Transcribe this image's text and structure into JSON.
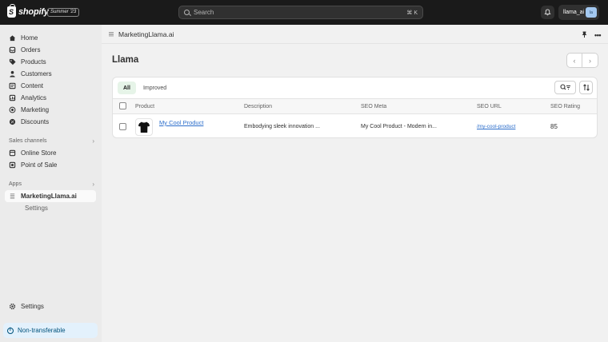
{
  "topbar": {
    "brand": "shopify",
    "edition": "Summer '23",
    "search_placeholder": "Search",
    "search_shortcut": "⌘ K",
    "account_name": "llama_ai",
    "avatar_initials": "la"
  },
  "sidebar": {
    "main_items": [
      {
        "label": "Home",
        "icon": "home-icon"
      },
      {
        "label": "Orders",
        "icon": "orders-icon"
      },
      {
        "label": "Products",
        "icon": "tag-icon"
      },
      {
        "label": "Customers",
        "icon": "person-icon"
      },
      {
        "label": "Content",
        "icon": "content-icon"
      },
      {
        "label": "Analytics",
        "icon": "analytics-icon"
      },
      {
        "label": "Marketing",
        "icon": "target-icon"
      },
      {
        "label": "Discounts",
        "icon": "discount-icon"
      }
    ],
    "sales_channels_label": "Sales channels",
    "sales_channels": [
      {
        "label": "Online Store",
        "icon": "store-icon"
      },
      {
        "label": "Point of Sale",
        "icon": "pos-icon"
      }
    ],
    "apps_label": "Apps",
    "apps": [
      {
        "label": "MarketingLlama.ai",
        "icon": "app-icon",
        "active": true
      },
      {
        "label": "Settings",
        "sub": true
      }
    ],
    "settings_label": "Settings",
    "non_transferable_label": "Non-transferable"
  },
  "appbar": {
    "title": "MarketingLlama.ai"
  },
  "page": {
    "title": "Llama"
  },
  "tabs": [
    "All",
    "Improved"
  ],
  "table": {
    "headers": {
      "product": "Product",
      "description": "Description",
      "seo_meta": "SEO Meta",
      "seo_url": "SEO URL",
      "seo_rating": "SEO Rating"
    },
    "rows": [
      {
        "product": "My Cool Product",
        "description": "Embodying sleek innovation ...",
        "seo_meta": "My Cool Product - Modern in...",
        "seo_url": "/my-cool-product",
        "seo_rating": "85"
      }
    ]
  },
  "colors": {
    "topbar_bg": "#1a1a1a",
    "sidebar_bg": "#ebebeb",
    "link": "#2c6ecb",
    "selected_tab_bg": "#e6f4e8",
    "info_banner_bg": "#e3f1fc"
  }
}
